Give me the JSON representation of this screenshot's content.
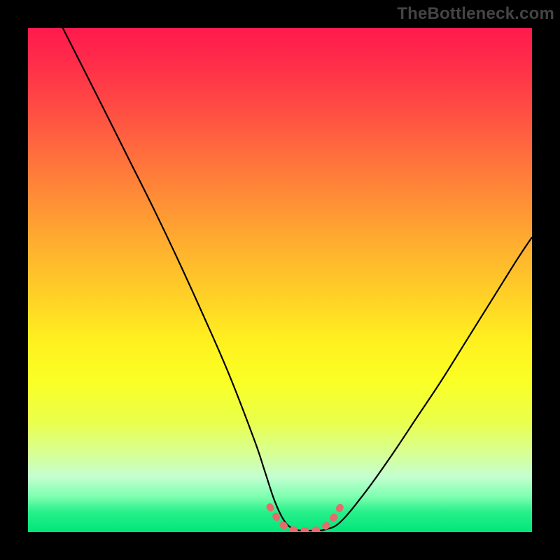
{
  "watermark": {
    "text": "TheBottleneck.com"
  },
  "gradient": {
    "top": "#ff1a4d",
    "mid_upper": "#ff8e36",
    "mid": "#fff01f",
    "mid_lower": "#d9ff90",
    "bottom": "#00e57a"
  },
  "curve_colors": {
    "main": "#000000",
    "accent": "#e86b6b"
  },
  "chart_data": {
    "type": "line",
    "title": "",
    "xlabel": "",
    "ylabel": "",
    "xlim": [
      0,
      100
    ],
    "ylim": [
      0,
      100
    ],
    "series": [
      {
        "name": "bottleneck-curve",
        "x": [
          6.9,
          15,
          20,
          25,
          30,
          35,
          40,
          45,
          47,
          49,
          51,
          53,
          55,
          57,
          59,
          62,
          67,
          72,
          77,
          82,
          87,
          92,
          97,
          100
        ],
        "values": [
          100,
          84,
          74,
          64,
          53.5,
          42.5,
          31,
          18,
          12,
          6,
          2,
          0.5,
          0.3,
          0.3,
          0.5,
          2,
          8,
          15,
          22.5,
          30,
          38,
          46,
          54,
          58.5
        ]
      },
      {
        "name": "flat-bottom-accent",
        "x": [
          48,
          50,
          52,
          54,
          56,
          58,
          60,
          62
        ],
        "values": [
          5,
          2,
          0.6,
          0.3,
          0.3,
          0.6,
          2,
          5
        ]
      }
    ]
  }
}
